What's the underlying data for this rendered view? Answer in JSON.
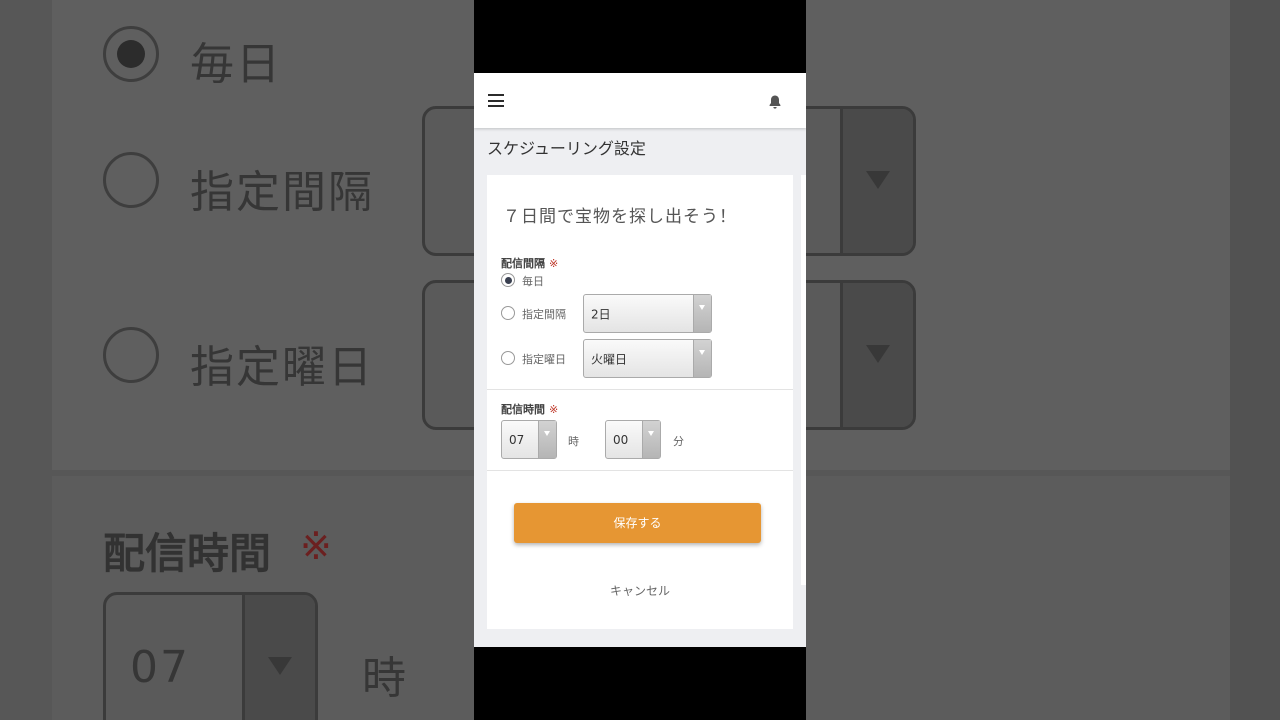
{
  "header": {
    "menu_icon": "hamburger-icon",
    "notification_icon": "bell-icon"
  },
  "page": {
    "title": "スケジューリング設定"
  },
  "card": {
    "title": "７日間で宝物を探し出そう！"
  },
  "delivery_interval": {
    "label": "配信間隔",
    "required_mark": "※",
    "options": [
      {
        "label": "毎日",
        "checked": true
      },
      {
        "label": "指定間隔",
        "checked": false,
        "select_value": "2日"
      },
      {
        "label": "指定曜日",
        "checked": false,
        "select_value": "火曜日"
      }
    ]
  },
  "delivery_time": {
    "label": "配信時間",
    "required_mark": "※",
    "hour_value": "07",
    "hour_unit": "時",
    "minute_value": "00",
    "minute_unit": "分"
  },
  "actions": {
    "save_label": "保存する",
    "cancel_label": "キャンセル"
  },
  "colors": {
    "accent": "#e69633",
    "required": "#c0392b"
  }
}
